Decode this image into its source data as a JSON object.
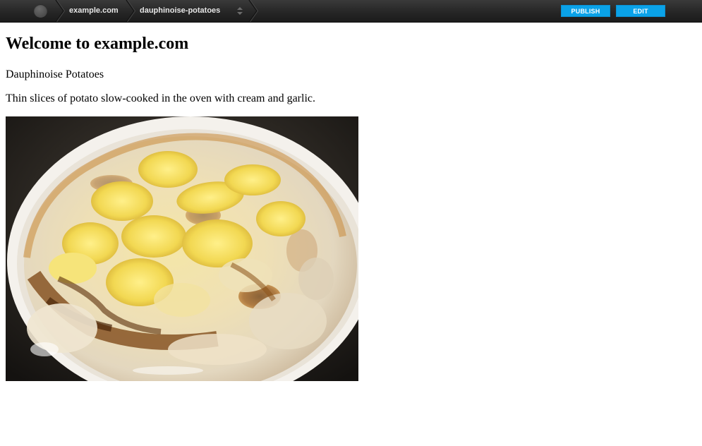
{
  "topbar": {
    "site_crumb": "example.com",
    "page_crumb": "dauphinoise-potatoes",
    "publish_label": "PUBLISH",
    "edit_label": "EDIT",
    "accent_color": "#0aa2e8",
    "icons": {
      "home": "circle-icon",
      "page_switch": "up-down-arrows-icon"
    }
  },
  "page": {
    "heading": "Welcome to example.com",
    "title": "Dauphinoise Potatoes",
    "description": "Thin slices of potato slow-cooked in the oven with cream and garlic.",
    "image_subject": "baked dauphinoise potatoes in a white dish"
  }
}
